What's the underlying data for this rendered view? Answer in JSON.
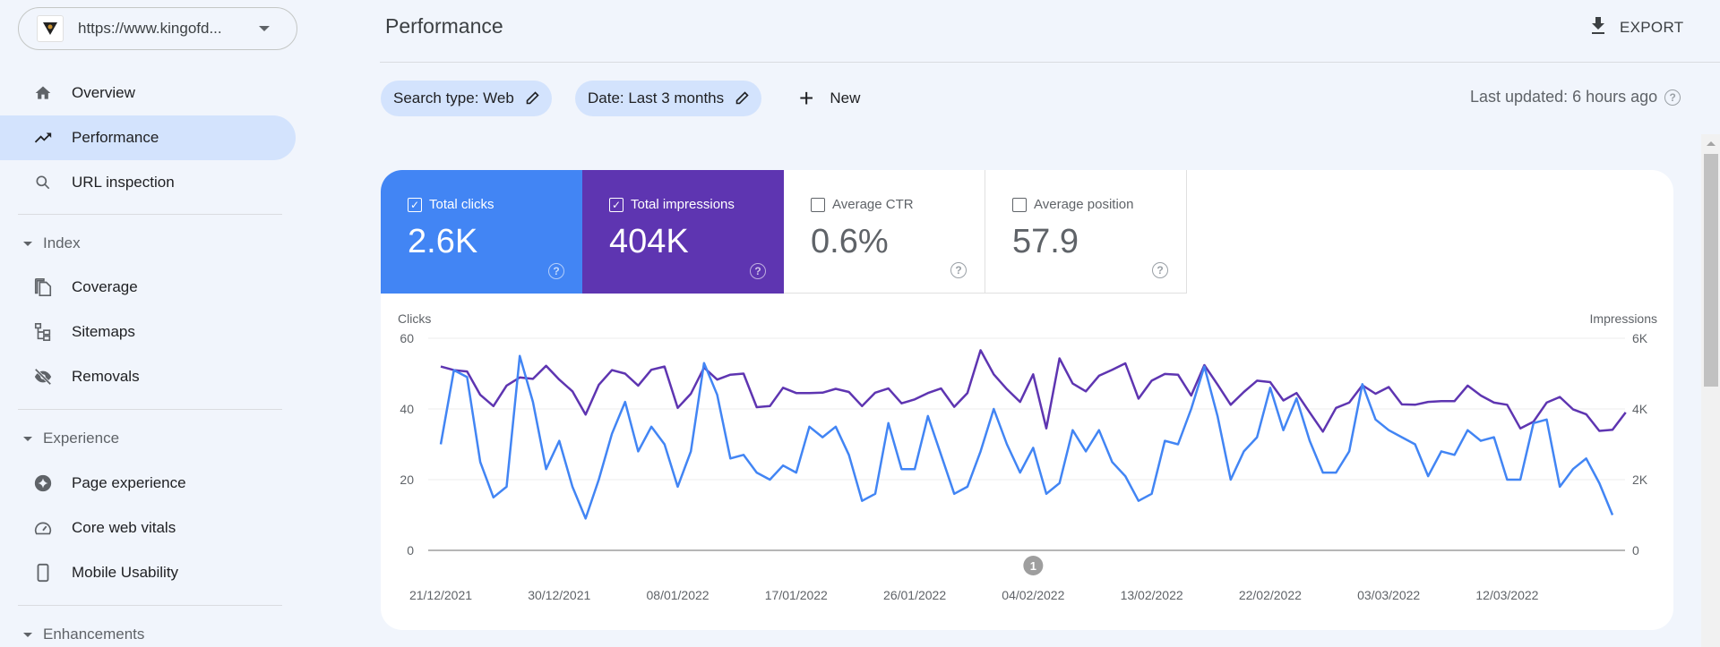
{
  "sidebar": {
    "property": {
      "url": "https://www.kingofd...",
      "icon": "site-favicon"
    },
    "items": [
      {
        "label": "Overview",
        "icon": "home-icon",
        "active": false
      },
      {
        "label": "Performance",
        "icon": "trending-up-icon",
        "active": true
      },
      {
        "label": "URL inspection",
        "icon": "search-icon",
        "active": false
      }
    ],
    "sections": [
      {
        "label": "Index",
        "items": [
          {
            "label": "Coverage",
            "icon": "file-copy-icon"
          },
          {
            "label": "Sitemaps",
            "icon": "sitemap-icon"
          },
          {
            "label": "Removals",
            "icon": "visibility-off-icon"
          }
        ]
      },
      {
        "label": "Experience",
        "items": [
          {
            "label": "Page experience",
            "icon": "star-circle-icon"
          },
          {
            "label": "Core web vitals",
            "icon": "speedometer-icon"
          },
          {
            "label": "Mobile Usability",
            "icon": "smartphone-icon"
          }
        ]
      },
      {
        "label": "Enhancements",
        "items": []
      }
    ]
  },
  "header": {
    "title": "Performance",
    "export_label": "EXPORT"
  },
  "filters": {
    "chips": [
      "Search type: Web",
      "Date: Last 3 months"
    ],
    "new_label": "New",
    "last_updated": "Last updated: 6 hours ago"
  },
  "metrics": [
    {
      "label": "Total clicks",
      "value": "2.6K",
      "checked": true,
      "color": "#4285f4"
    },
    {
      "label": "Total impressions",
      "value": "404K",
      "checked": true,
      "color": "#5e35b1"
    },
    {
      "label": "Average CTR",
      "value": "0.6%",
      "checked": false
    },
    {
      "label": "Average position",
      "value": "57.9",
      "checked": false
    }
  ],
  "chart_data": {
    "type": "line",
    "left_axis": {
      "label": "Clicks",
      "ticks": [
        "0",
        "20",
        "40",
        "60"
      ],
      "range": [
        0,
        60
      ]
    },
    "right_axis": {
      "label": "Impressions",
      "ticks": [
        "0",
        "2K",
        "4K",
        "6K"
      ],
      "range": [
        0,
        6000
      ]
    },
    "x_tick_labels": [
      "21/12/2021",
      "30/12/2021",
      "08/01/2022",
      "17/01/2022",
      "26/01/2022",
      "04/02/2022",
      "13/02/2022",
      "22/02/2022",
      "03/03/2022",
      "12/03/2022"
    ],
    "annotation": {
      "label": "1",
      "date_index": 45
    },
    "grid": true,
    "series": [
      {
        "name": "Clicks",
        "axis": "left",
        "color": "#4285f4",
        "values": [
          30,
          51,
          49,
          25,
          15,
          18,
          55,
          42,
          23,
          31,
          18,
          9,
          20,
          33,
          42,
          28,
          35,
          30,
          18,
          28,
          53,
          44,
          26,
          27,
          22,
          20,
          24,
          22,
          35,
          32,
          35,
          27,
          14,
          16,
          36,
          23,
          23,
          38,
          27,
          16,
          18,
          28,
          40,
          30,
          22,
          29,
          16,
          19,
          34,
          28,
          34,
          25,
          21,
          14,
          16,
          31,
          30,
          40,
          52,
          38,
          20,
          28,
          32,
          46,
          34,
          43,
          31,
          22,
          22,
          28,
          47,
          37,
          34,
          32,
          30,
          21,
          28,
          27,
          34,
          31,
          32,
          20,
          20,
          36,
          37,
          18,
          23,
          26,
          19,
          10
        ]
      },
      {
        "name": "Impressions",
        "axis": "right",
        "color": "#5e35b1",
        "values": [
          5200,
          5100,
          5060,
          4400,
          4080,
          4660,
          4890,
          4850,
          5220,
          4830,
          4500,
          3840,
          4680,
          5100,
          5000,
          4660,
          5110,
          5200,
          4030,
          4430,
          5170,
          4830,
          4970,
          5000,
          4050,
          4080,
          4600,
          4450,
          4450,
          4460,
          4570,
          4480,
          4080,
          4460,
          4580,
          4160,
          4270,
          4450,
          4580,
          4060,
          4450,
          5660,
          4980,
          4560,
          4200,
          4980,
          3450,
          5430,
          4720,
          4500,
          4940,
          5110,
          5290,
          4290,
          4800,
          4990,
          4970,
          4380,
          5240,
          4690,
          4120,
          4480,
          4800,
          4760,
          4240,
          4450,
          3900,
          3360,
          4030,
          4180,
          4670,
          4430,
          4620,
          4130,
          4120,
          4200,
          4220,
          4220,
          4660,
          4380,
          4180,
          4120,
          3450,
          3640,
          4180,
          4340,
          3990,
          3850,
          3380,
          3410,
          3900
        ]
      }
    ]
  }
}
